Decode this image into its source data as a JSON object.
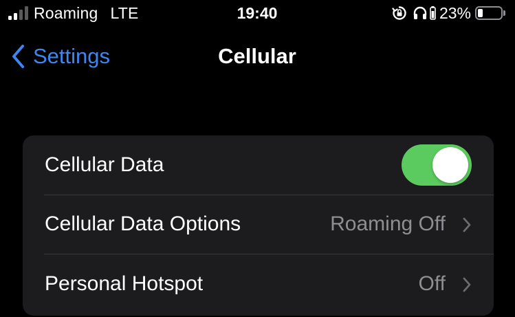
{
  "status_bar": {
    "carrier": "Roaming",
    "network": "LTE",
    "time": "19:40",
    "battery_percent": "23%",
    "battery_level": 0.23,
    "signal_bars_active": 2,
    "icons": [
      "signal-icon",
      "rotation-lock-icon",
      "headphones-icon",
      "battery-icon"
    ]
  },
  "nav": {
    "back_label": "Settings",
    "title": "Cellular"
  },
  "settings": {
    "rows": [
      {
        "label": "Cellular Data",
        "control": "toggle",
        "enabled": true
      },
      {
        "label": "Cellular Data Options",
        "value": "Roaming Off"
      },
      {
        "label": "Personal Hotspot",
        "value": "Off"
      }
    ]
  },
  "colors": {
    "background": "#000000",
    "group_background": "#1c1c1e",
    "accent_blue": "#3e86f0",
    "toggle_on_green": "#5ccb5f",
    "secondary_text": "#8e8e93"
  }
}
